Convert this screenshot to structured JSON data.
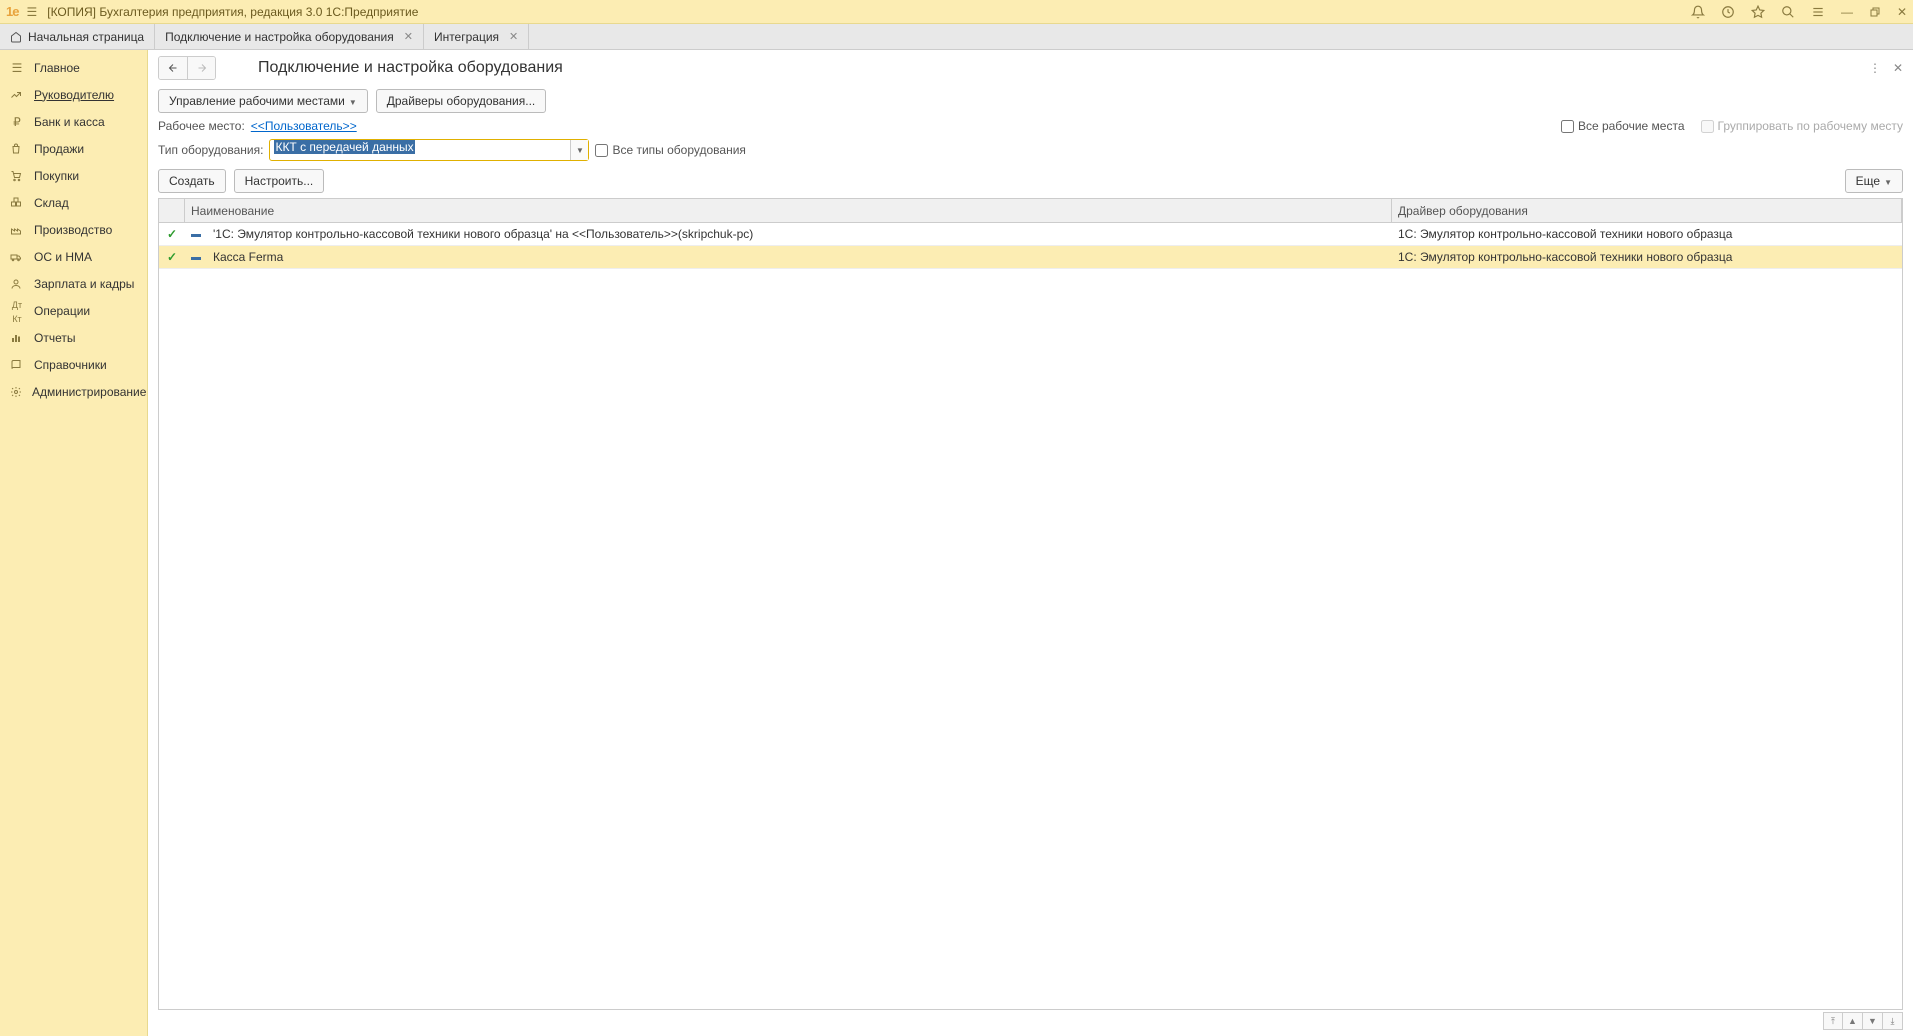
{
  "window_title": "[КОПИЯ] Бухгалтерия предприятия, редакция 3.0 1С:Предприятие",
  "logo_text": "1e",
  "tabs": {
    "home": "Начальная страница",
    "t1": "Подключение и настройка оборудования",
    "t2": "Интеграция"
  },
  "sidebar": {
    "items": [
      {
        "label": "Главное"
      },
      {
        "label": "Руководителю"
      },
      {
        "label": "Банк и касса"
      },
      {
        "label": "Продажи"
      },
      {
        "label": "Покупки"
      },
      {
        "label": "Склад"
      },
      {
        "label": "Производство"
      },
      {
        "label": "ОС и НМА"
      },
      {
        "label": "Зарплата и кадры"
      },
      {
        "label": "Операции"
      },
      {
        "label": "Отчеты"
      },
      {
        "label": "Справочники"
      },
      {
        "label": "Администрирование"
      }
    ]
  },
  "content": {
    "title": "Подключение и настройка оборудования",
    "btn_workplaces": "Управление рабочими местами",
    "btn_drivers": "Драйверы оборудования...",
    "label_workplace": "Рабочее место:",
    "link_user": "<<Пользователь>>",
    "chk_all_workplaces": "Все рабочие места",
    "chk_group_by": "Группировать по рабочему месту",
    "label_equip_type": "Тип оборудования:",
    "combo_value": "ККТ с передачей данных",
    "chk_all_types": "Все типы оборудования",
    "btn_create": "Создать",
    "btn_configure": "Настроить...",
    "btn_more": "Еще"
  },
  "table": {
    "col_name": "Наименование",
    "col_driver": "Драйвер оборудования",
    "rows": [
      {
        "name": "'1С: Эмулятор контрольно-кассовой техники нового образца' на <<Пользователь>>(skripchuk-pc)",
        "driver": "1С: Эмулятор контрольно-кассовой техники нового образца"
      },
      {
        "name": "Касса Ferma",
        "driver": "1С: Эмулятор контрольно-кассовой техники нового образца"
      }
    ]
  }
}
